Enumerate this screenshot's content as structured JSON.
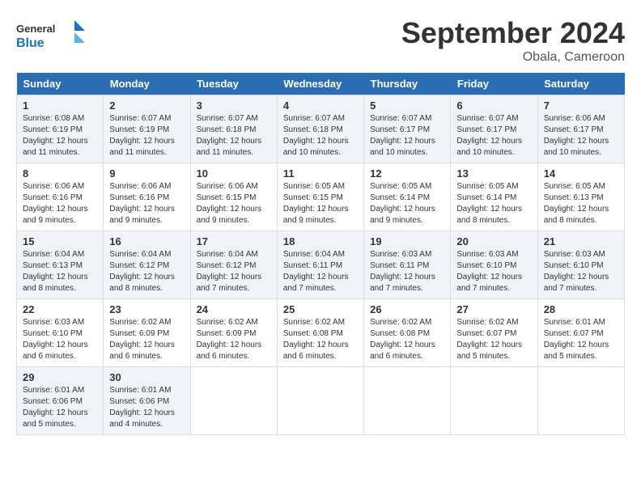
{
  "header": {
    "logo_general": "General",
    "logo_blue": "Blue",
    "month_title": "September 2024",
    "location": "Obala, Cameroon"
  },
  "calendar": {
    "days_of_week": [
      "Sunday",
      "Monday",
      "Tuesday",
      "Wednesday",
      "Thursday",
      "Friday",
      "Saturday"
    ],
    "weeks": [
      [
        {
          "day": "1",
          "info": "Sunrise: 6:08 AM\nSunset: 6:19 PM\nDaylight: 12 hours\nand 11 minutes."
        },
        {
          "day": "2",
          "info": "Sunrise: 6:07 AM\nSunset: 6:19 PM\nDaylight: 12 hours\nand 11 minutes."
        },
        {
          "day": "3",
          "info": "Sunrise: 6:07 AM\nSunset: 6:18 PM\nDaylight: 12 hours\nand 11 minutes."
        },
        {
          "day": "4",
          "info": "Sunrise: 6:07 AM\nSunset: 6:18 PM\nDaylight: 12 hours\nand 10 minutes."
        },
        {
          "day": "5",
          "info": "Sunrise: 6:07 AM\nSunset: 6:17 PM\nDaylight: 12 hours\nand 10 minutes."
        },
        {
          "day": "6",
          "info": "Sunrise: 6:07 AM\nSunset: 6:17 PM\nDaylight: 12 hours\nand 10 minutes."
        },
        {
          "day": "7",
          "info": "Sunrise: 6:06 AM\nSunset: 6:17 PM\nDaylight: 12 hours\nand 10 minutes."
        }
      ],
      [
        {
          "day": "8",
          "info": "Sunrise: 6:06 AM\nSunset: 6:16 PM\nDaylight: 12 hours\nand 9 minutes."
        },
        {
          "day": "9",
          "info": "Sunrise: 6:06 AM\nSunset: 6:16 PM\nDaylight: 12 hours\nand 9 minutes."
        },
        {
          "day": "10",
          "info": "Sunrise: 6:06 AM\nSunset: 6:15 PM\nDaylight: 12 hours\nand 9 minutes."
        },
        {
          "day": "11",
          "info": "Sunrise: 6:05 AM\nSunset: 6:15 PM\nDaylight: 12 hours\nand 9 minutes."
        },
        {
          "day": "12",
          "info": "Sunrise: 6:05 AM\nSunset: 6:14 PM\nDaylight: 12 hours\nand 9 minutes."
        },
        {
          "day": "13",
          "info": "Sunrise: 6:05 AM\nSunset: 6:14 PM\nDaylight: 12 hours\nand 8 minutes."
        },
        {
          "day": "14",
          "info": "Sunrise: 6:05 AM\nSunset: 6:13 PM\nDaylight: 12 hours\nand 8 minutes."
        }
      ],
      [
        {
          "day": "15",
          "info": "Sunrise: 6:04 AM\nSunset: 6:13 PM\nDaylight: 12 hours\nand 8 minutes."
        },
        {
          "day": "16",
          "info": "Sunrise: 6:04 AM\nSunset: 6:12 PM\nDaylight: 12 hours\nand 8 minutes."
        },
        {
          "day": "17",
          "info": "Sunrise: 6:04 AM\nSunset: 6:12 PM\nDaylight: 12 hours\nand 7 minutes."
        },
        {
          "day": "18",
          "info": "Sunrise: 6:04 AM\nSunset: 6:11 PM\nDaylight: 12 hours\nand 7 minutes."
        },
        {
          "day": "19",
          "info": "Sunrise: 6:03 AM\nSunset: 6:11 PM\nDaylight: 12 hours\nand 7 minutes."
        },
        {
          "day": "20",
          "info": "Sunrise: 6:03 AM\nSunset: 6:10 PM\nDaylight: 12 hours\nand 7 minutes."
        },
        {
          "day": "21",
          "info": "Sunrise: 6:03 AM\nSunset: 6:10 PM\nDaylight: 12 hours\nand 7 minutes."
        }
      ],
      [
        {
          "day": "22",
          "info": "Sunrise: 6:03 AM\nSunset: 6:10 PM\nDaylight: 12 hours\nand 6 minutes."
        },
        {
          "day": "23",
          "info": "Sunrise: 6:02 AM\nSunset: 6:09 PM\nDaylight: 12 hours\nand 6 minutes."
        },
        {
          "day": "24",
          "info": "Sunrise: 6:02 AM\nSunset: 6:09 PM\nDaylight: 12 hours\nand 6 minutes."
        },
        {
          "day": "25",
          "info": "Sunrise: 6:02 AM\nSunset: 6:08 PM\nDaylight: 12 hours\nand 6 minutes."
        },
        {
          "day": "26",
          "info": "Sunrise: 6:02 AM\nSunset: 6:08 PM\nDaylight: 12 hours\nand 6 minutes."
        },
        {
          "day": "27",
          "info": "Sunrise: 6:02 AM\nSunset: 6:07 PM\nDaylight: 12 hours\nand 5 minutes."
        },
        {
          "day": "28",
          "info": "Sunrise: 6:01 AM\nSunset: 6:07 PM\nDaylight: 12 hours\nand 5 minutes."
        }
      ],
      [
        {
          "day": "29",
          "info": "Sunrise: 6:01 AM\nSunset: 6:06 PM\nDaylight: 12 hours\nand 5 minutes."
        },
        {
          "day": "30",
          "info": "Sunrise: 6:01 AM\nSunset: 6:06 PM\nDaylight: 12 hours\nand 4 minutes."
        },
        {
          "day": "",
          "info": ""
        },
        {
          "day": "",
          "info": ""
        },
        {
          "day": "",
          "info": ""
        },
        {
          "day": "",
          "info": ""
        },
        {
          "day": "",
          "info": ""
        }
      ]
    ]
  }
}
